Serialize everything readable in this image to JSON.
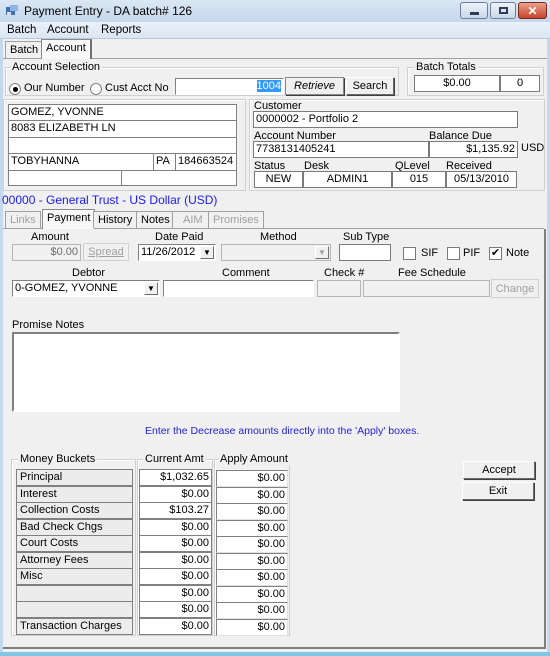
{
  "window": {
    "title": "Payment Entry - DA batch# 126",
    "controls": {
      "minimize": "minimize-icon",
      "maximize": "maximize-icon",
      "close": "close-icon"
    }
  },
  "menu": [
    "Batch",
    "Account",
    "Reports"
  ],
  "top_tabs": [
    {
      "label": "Batch",
      "active": false
    },
    {
      "label": "Account",
      "active": true
    }
  ],
  "account_selection": {
    "label": "Account Selection",
    "radio_our_number": "Our Number",
    "radio_cust_acct": "Cust Acct No",
    "selected": "Our Number",
    "input_value": "1004",
    "retrieve_label": "Retrieve",
    "search_label": "Search"
  },
  "batch_totals": {
    "label": "Batch Totals",
    "amount": "$0.00",
    "count": "0"
  },
  "address": {
    "name": "GOMEZ, YVONNE",
    "line1": "8083 ELIZABETH LN",
    "line2": "",
    "city": "TOBYHANNA",
    "state": "PA",
    "zip": "184663524",
    "extra1": "",
    "extra2": ""
  },
  "account_info": {
    "customer_label": "Customer",
    "customer_value": "0000002 - Portfolio 2",
    "account_number_label": "Account Number",
    "account_number_value": "7738131405241",
    "balance_due_label": "Balance Due",
    "balance_due_value": "$1,135.92",
    "currency": "USD",
    "status_label": "Status",
    "status_value": "NEW",
    "desk_label": "Desk",
    "desk_value": "ADMIN1",
    "qlevel_label": "QLevel",
    "qlevel_value": "015",
    "received_label": "Received",
    "received_value": "05/13/2010"
  },
  "trust_line": "00000 - General Trust - US Dollar (USD)",
  "colors": {
    "trust_text": "#1a1aff",
    "info_text": "#2222dd"
  },
  "sub_tabs": [
    {
      "label": "Links",
      "state": "disabled"
    },
    {
      "label": "Payment",
      "state": "active"
    },
    {
      "label": "History",
      "state": "normal"
    },
    {
      "label": "Notes",
      "state": "normal"
    },
    {
      "label": "AIM",
      "state": "disabled"
    },
    {
      "label": "Promises",
      "state": "disabled"
    }
  ],
  "payment": {
    "amount_label": "Amount",
    "amount_value": "$0.00",
    "spread_label": "Spread",
    "date_paid_label": "Date Paid",
    "date_paid_value": "11/26/2012",
    "method_label": "Method",
    "method_value": "",
    "sub_type_label": "Sub Type",
    "sub_type_value": "",
    "sif_label": "SIF",
    "sif_checked": false,
    "pif_label": "PIF",
    "pif_checked": false,
    "note_label": "Note",
    "note_checked": true,
    "debtor_label": "Debtor",
    "debtor_value": "0-GOMEZ, YVONNE",
    "comment_label": "Comment",
    "comment_value": "",
    "check_label": "Check #",
    "check_value": "",
    "fee_schedule_label": "Fee Schedule",
    "fee_schedule_value": "",
    "change_label": "Change",
    "promise_notes_label": "Promise Notes",
    "promise_notes_value": "",
    "instruction": "Enter the Decrease amounts directly into the 'Apply' boxes."
  },
  "buckets": {
    "header_bucket": "Money Buckets",
    "header_current": "Current Amt",
    "header_apply": "Apply Amount",
    "rows": [
      {
        "name": "Principal",
        "current": "$1,032.65",
        "apply": "$0.00"
      },
      {
        "name": "Interest",
        "current": "$0.00",
        "apply": "$0.00"
      },
      {
        "name": "Collection Costs",
        "current": "$103.27",
        "apply": "$0.00"
      },
      {
        "name": "Bad Check Chgs",
        "current": "$0.00",
        "apply": "$0.00"
      },
      {
        "name": "Court Costs",
        "current": "$0.00",
        "apply": "$0.00"
      },
      {
        "name": "Attorney Fees",
        "current": "$0.00",
        "apply": "$0.00"
      },
      {
        "name": "Misc",
        "current": "$0.00",
        "apply": "$0.00"
      },
      {
        "name": "",
        "current": "$0.00",
        "apply": "$0.00"
      },
      {
        "name": "",
        "current": "$0.00",
        "apply": "$0.00"
      },
      {
        "name": "Transaction Charges",
        "current": "$0.00",
        "apply": "$0.00"
      }
    ]
  },
  "actions": {
    "accept": "Accept",
    "exit": "Exit"
  }
}
